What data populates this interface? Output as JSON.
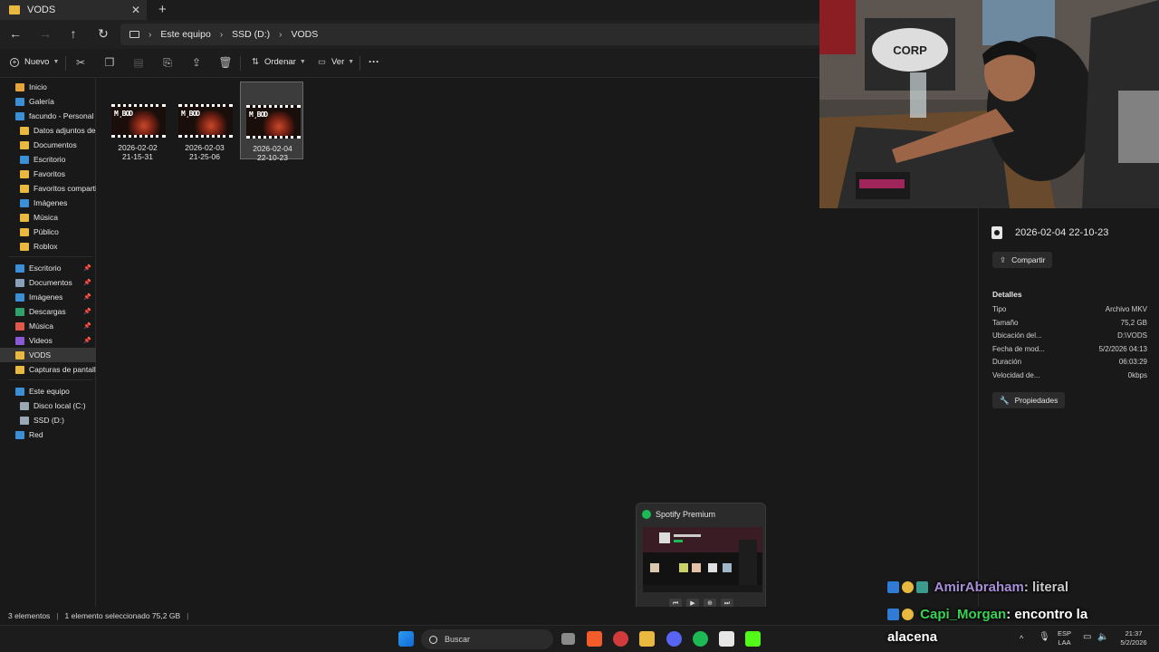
{
  "window": {
    "tab_title": "VODS",
    "tab_close": "✕",
    "new_tab": "+"
  },
  "breadcrumb": [
    "Este equipo",
    "SSD (D:)",
    "VODS"
  ],
  "commands": {
    "new": "Nuevo",
    "sort": "Ordenar",
    "view": "Ver",
    "more": "···"
  },
  "sidebar": {
    "quick": [
      {
        "label": "Inicio",
        "icon": "home-icon",
        "color": "#e8a33a"
      },
      {
        "label": "Galería",
        "icon": "gallery-icon",
        "color": "#3b8fd6"
      },
      {
        "label": "facundo - Personal",
        "icon": "onedrive-icon",
        "color": "#3b8fd6"
      },
      {
        "label": "Datos adjuntos de c",
        "icon": "folder-icon",
        "color": "#e8b93e"
      },
      {
        "label": "Documentos",
        "icon": "folder-icon",
        "color": "#e8b93e"
      },
      {
        "label": "Escritorio",
        "icon": "desktop-icon",
        "color": "#3b8fd6"
      },
      {
        "label": "Favoritos",
        "icon": "folder-icon",
        "color": "#e8b93e"
      },
      {
        "label": "Favoritos comparti",
        "icon": "folder-icon",
        "color": "#e8b93e"
      },
      {
        "label": "Imágenes",
        "icon": "pictures-icon",
        "color": "#3b8fd6"
      },
      {
        "label": "Música",
        "icon": "folder-icon",
        "color": "#e8b93e"
      },
      {
        "label": "Público",
        "icon": "folder-icon",
        "color": "#e8b93e"
      },
      {
        "label": "Roblox",
        "icon": "folder-icon",
        "color": "#e8b93e"
      }
    ],
    "pinned": [
      {
        "label": "Escritorio",
        "icon": "desktop-icon",
        "color": "#3b8fd6",
        "pinned": true
      },
      {
        "label": "Documentos",
        "icon": "documents-icon",
        "color": "#8aa0b8",
        "pinned": true
      },
      {
        "label": "Imágenes",
        "icon": "pictures-icon",
        "color": "#3b8fd6",
        "pinned": true
      },
      {
        "label": "Descargas",
        "icon": "downloads-icon",
        "color": "#2fa36b",
        "pinned": true
      },
      {
        "label": "Música",
        "icon": "music-icon",
        "color": "#e0584a",
        "pinned": true
      },
      {
        "label": "Videos",
        "icon": "videos-icon",
        "color": "#8a5ad6",
        "pinned": true
      },
      {
        "label": "VODS",
        "icon": "folder-icon",
        "color": "#e8b93e",
        "pinned": false,
        "active": true
      },
      {
        "label": "Capturas de pantalla",
        "icon": "folder-icon",
        "color": "#e8b93e",
        "pinned": false
      }
    ],
    "devices": [
      {
        "label": "Este equipo",
        "icon": "pc-icon",
        "color": "#3b8fd6"
      },
      {
        "label": "Disco local (C:)",
        "icon": "drive-icon",
        "color": "#9aa7b5"
      },
      {
        "label": "SSD (D:)",
        "icon": "drive-icon",
        "color": "#9aa7b5"
      },
      {
        "label": "Red",
        "icon": "network-icon",
        "color": "#3b8fd6"
      }
    ]
  },
  "files": [
    {
      "line1": "2026-02-02",
      "line2": "21-15-31",
      "selected": false
    },
    {
      "line1": "2026-02-03",
      "line2": "21-25-06",
      "selected": false
    },
    {
      "line1": "2026-02-04",
      "line2": "22-10-23",
      "selected": true
    }
  ],
  "details": {
    "title": "2026-02-04 22-10-23",
    "share": "Compartir",
    "heading": "Detalles",
    "rows": [
      {
        "k": "Tipo",
        "v": "Archivo MKV"
      },
      {
        "k": "Tamaño",
        "v": "75,2 GB"
      },
      {
        "k": "Ubicación del...",
        "v": "D:\\VODS"
      },
      {
        "k": "Fecha de mod...",
        "v": "5/2/2026 04:13"
      },
      {
        "k": "Duración",
        "v": "06:03:29"
      },
      {
        "k": "Velocidad de...",
        "v": "0kbps"
      }
    ],
    "properties": "Propiedades"
  },
  "status": {
    "count": "3 elementos",
    "selection": "1 elemento seleccionado  75,2 GB"
  },
  "spotify": {
    "title": "Spotify Premium"
  },
  "taskbar": {
    "search": "Buscar",
    "lang1": "ESP",
    "lang2": "LAA",
    "time": "21:37",
    "date": "5/2/2026"
  },
  "chat": [
    {
      "user": "AmirAbraham",
      "user_color": "#a98fd8",
      "message": ": literal"
    },
    {
      "user": "Capi_Morgan",
      "user_color": "#39d353",
      "message": ": encontro la",
      "continuation": "alacena"
    }
  ]
}
